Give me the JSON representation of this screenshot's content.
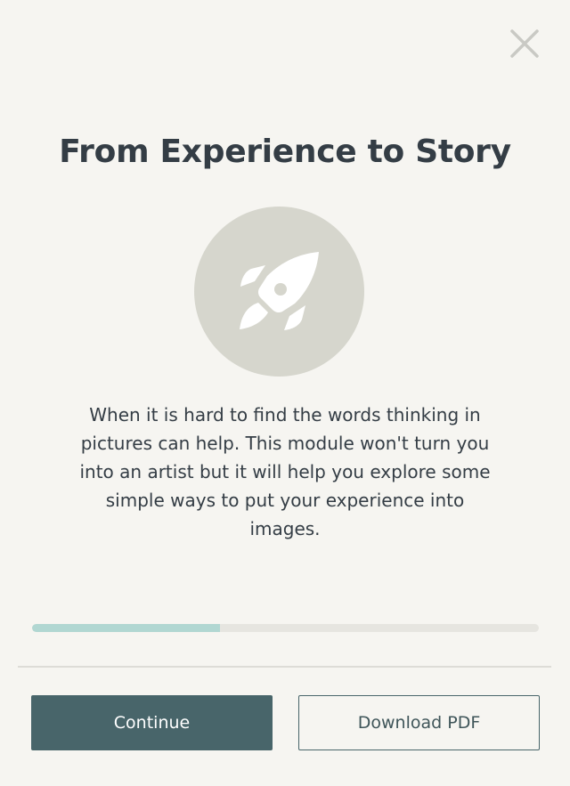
{
  "modal": {
    "title": "From Experience to Story",
    "close_icon": "close-icon",
    "hero_icon": "rocket-icon",
    "description": "When it is hard to find the words thinking in pictures can help. This module won't turn you into an artist but it will help you explore some simple ways to put your experience into images.",
    "progress_fraction": 0.37,
    "buttons": {
      "continue_label": "Continue",
      "download_label": "Download PDF"
    },
    "colors": {
      "background": "#f6f5f1",
      "text": "#343d45",
      "primary": "#48656a",
      "progress_fill": "#b1d7d2",
      "progress_track": "#e6e5e0",
      "hero_circle": "#d6d6cd"
    }
  }
}
